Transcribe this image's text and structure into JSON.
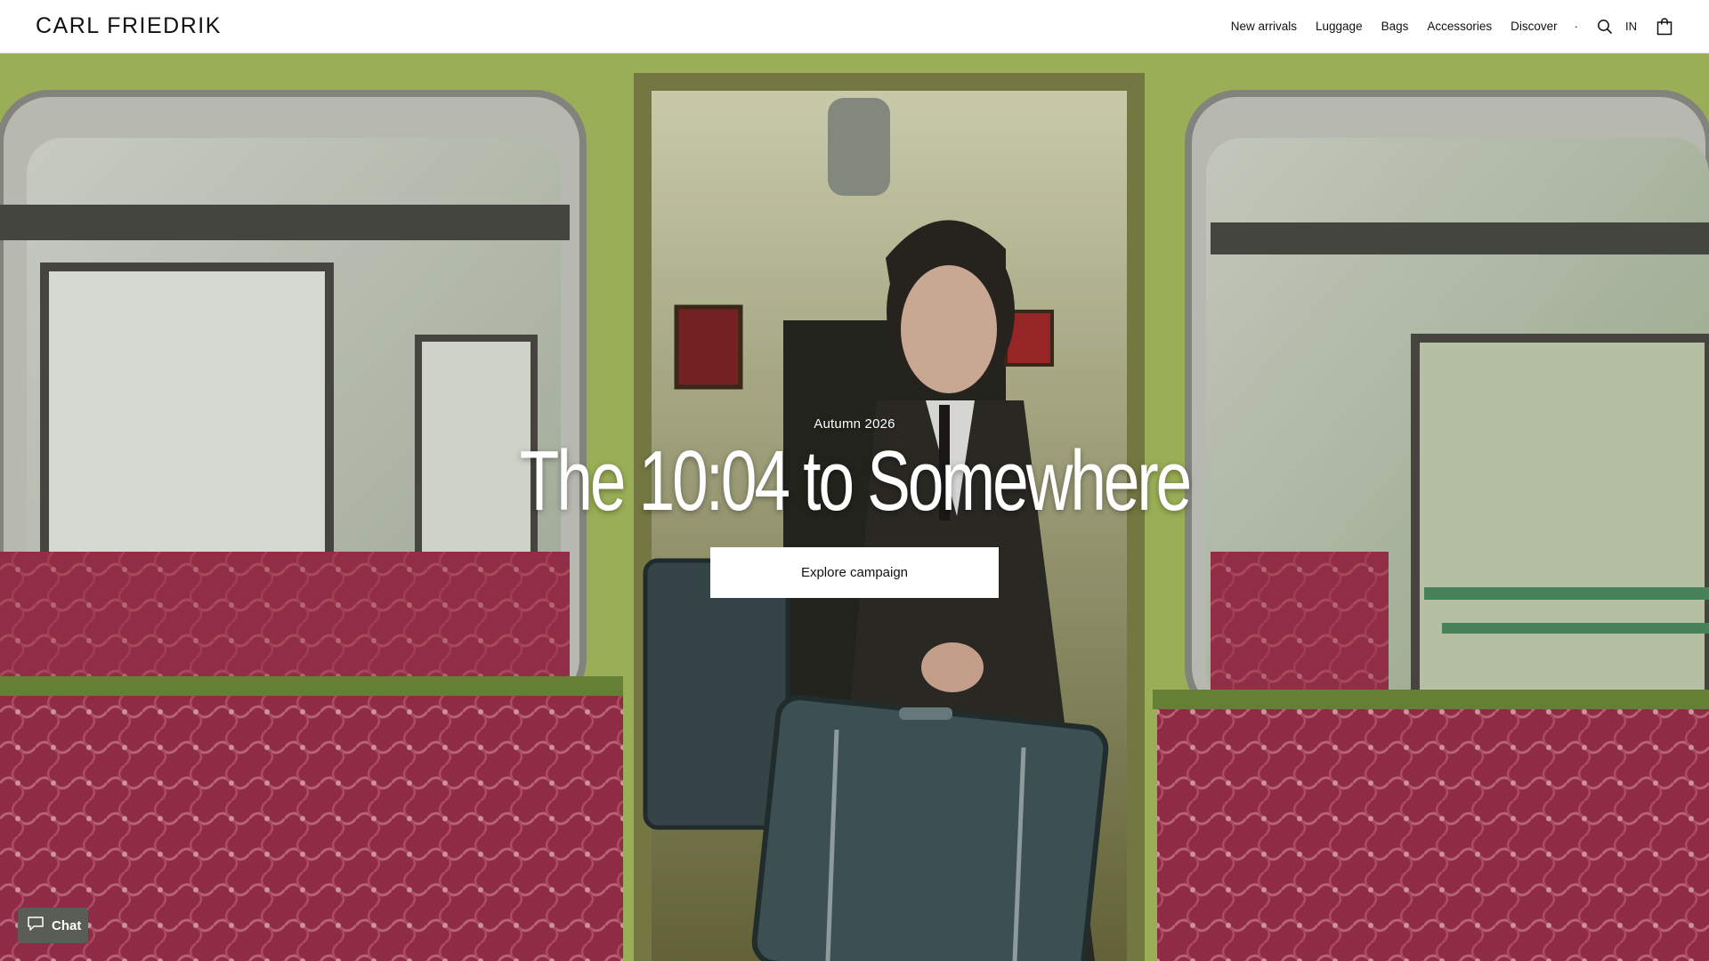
{
  "header": {
    "logo": "CARL FRIEDRIK",
    "nav": [
      {
        "label": "New arrivals"
      },
      {
        "label": "Luggage"
      },
      {
        "label": "Bags"
      },
      {
        "label": "Accessories"
      },
      {
        "label": "Discover"
      }
    ],
    "separator": "·",
    "search_icon": "search-icon",
    "locale": "IN",
    "cart_icon": "shopping-bag-icon"
  },
  "hero": {
    "eyebrow": "Autumn 2026",
    "headline": "The 10:04 to Somewhere",
    "cta_label": "Explore campaign",
    "colors": {
      "carriage_green": "#a8bd5f",
      "seat_red": "#9c2f4a",
      "text": "#ffffff"
    }
  },
  "chat": {
    "label": "Chat",
    "icon": "chat-bubble-icon"
  }
}
